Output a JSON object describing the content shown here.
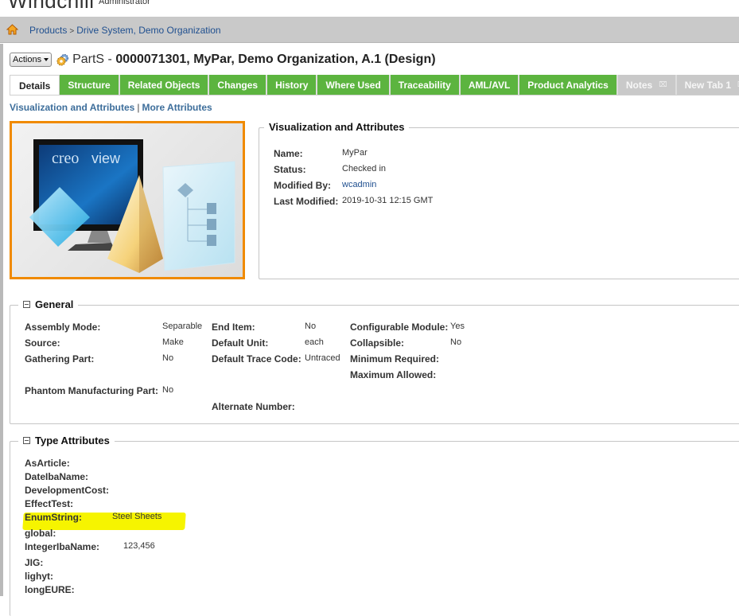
{
  "app": {
    "brand": "Windchill",
    "user_role": "Administrator"
  },
  "breadcrumb": {
    "home_icon": "home-icon",
    "items": [
      "Products",
      "Drive System, Demo Organization"
    ],
    "separator": ">"
  },
  "header": {
    "actions_label": "Actions",
    "type_icon": "gear-icon",
    "object_type": "PartS",
    "dash": " - ",
    "object_title": "0000071301, MyPar, Demo Organization, A.1 (Design)"
  },
  "tabs": [
    {
      "label": "Details",
      "state": "active"
    },
    {
      "label": "Structure",
      "state": "normal"
    },
    {
      "label": "Related Objects",
      "state": "normal"
    },
    {
      "label": "Changes",
      "state": "normal"
    },
    {
      "label": "History",
      "state": "normal"
    },
    {
      "label": "Where Used",
      "state": "normal"
    },
    {
      "label": "Traceability",
      "state": "normal"
    },
    {
      "label": "AML/AVL",
      "state": "normal"
    },
    {
      "label": "Product Analytics",
      "state": "normal"
    },
    {
      "label": "Notes",
      "state": "closable"
    },
    {
      "label": "New Tab 1",
      "state": "closable"
    }
  ],
  "subnav": {
    "links": [
      "Visualization and Attributes",
      "More Attributes"
    ],
    "divider": "|"
  },
  "visualization": {
    "thumbnail_text": "creo view",
    "legend": "Visualization and Attributes",
    "fields": [
      {
        "label": "Name:",
        "value": "MyPar"
      },
      {
        "label": "Status:",
        "value": "Checked in"
      },
      {
        "label": "Modified By:",
        "value": "wcadmin"
      },
      {
        "label": "Last Modified:",
        "value": "2019-10-31 12:15 GMT"
      }
    ]
  },
  "general": {
    "legend": "General",
    "col1": [
      {
        "label": "Assembly Mode:",
        "value": "Separable"
      },
      {
        "label": "Source:",
        "value": "Make"
      },
      {
        "label": "Gathering Part:",
        "value": "No"
      },
      {
        "label": "Phantom Manufacturing Part:",
        "value": "No"
      }
    ],
    "col2": [
      {
        "label": "End Item:",
        "value": "No"
      },
      {
        "label": "Default Unit:",
        "value": "each"
      },
      {
        "label": "Default Trace Code:",
        "value": "Untraced"
      },
      {
        "label": "Alternate Number:",
        "value": ""
      }
    ],
    "col3": [
      {
        "label": "Configurable Module:",
        "value": "Yes"
      },
      {
        "label": "Collapsible:",
        "value": "No"
      },
      {
        "label": "Minimum Required:",
        "value": ""
      },
      {
        "label": "Maximum Allowed:",
        "value": ""
      }
    ]
  },
  "type_attributes": {
    "legend": "Type Attributes",
    "highlight_color": "#f6f400",
    "items": [
      {
        "label": "AsArticle:",
        "value": ""
      },
      {
        "label": "DateIbaName:",
        "value": ""
      },
      {
        "label": "DevelopmentCost:",
        "value": ""
      },
      {
        "label": "EffectTest:",
        "value": ""
      },
      {
        "label": "EnumString:",
        "value": "Steel Sheets",
        "highlighted": true
      },
      {
        "label": "global:",
        "value": ""
      },
      {
        "label": "IntegerIbaName:",
        "value": "123,456"
      },
      {
        "label": "JIG:",
        "value": ""
      },
      {
        "label": "lighyt:",
        "value": ""
      },
      {
        "label": "longEURE:",
        "value": ""
      }
    ]
  },
  "colors": {
    "tab_green": "#5cb43f",
    "tab_gray": "#c9c9c9",
    "link_blue": "#1f4f8f",
    "thumbnail_border": "#f08a00"
  }
}
